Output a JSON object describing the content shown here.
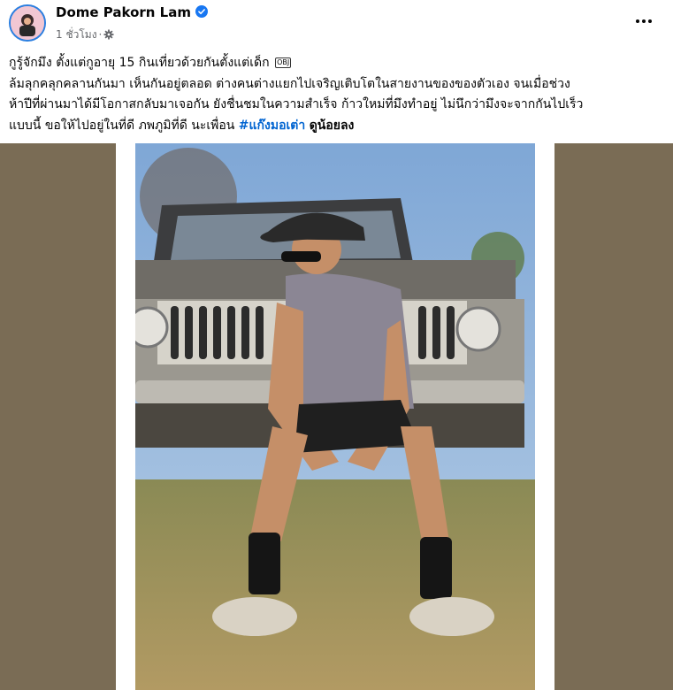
{
  "post": {
    "author": "Dome Pakorn Lam",
    "timestamp": "1 ชั่วโมง",
    "separator": "·",
    "verified_icon": "verified-badge-icon",
    "audience_icon": "gear-icon",
    "more_icon": "more-options-icon",
    "text": {
      "line1_text": "กูรู้จักมึง ตั้งแต่กูอายุ 15 กินเที่ยวด้วยกันตั้งแต่เด็ก",
      "line1_badge": "OBJ",
      "line2": "ล้มลุกคลุกคลานกันมา เห็นกันอยู่ตลอด ต่างคนต่างแยกไปเจริญเติบโตในสายงานของของตัวเอง จนเมื่อช่วง",
      "line3": "ห้าปีที่ผ่านมาได้มีโอกาสกลับมาเจอกัน ยังชื่นชมในความสำเร็จ ก้าวใหม่ที่มึงทำอยู่ ไม่นึกว่ามึงจะจากกันไปเร็ว",
      "line4_text": "แบบนี้ ขอให้ไปอยู่ในที่ดี ภพภูมิที่ดี นะเพื่อน ",
      "hashtag": "#แก๊งมอเต่า",
      "mention": "ดูน้อยลง"
    },
    "colors": {
      "link": "#0064d1",
      "media_background": "#7a6c55",
      "avatar_ring": "#2b7fe0"
    }
  }
}
